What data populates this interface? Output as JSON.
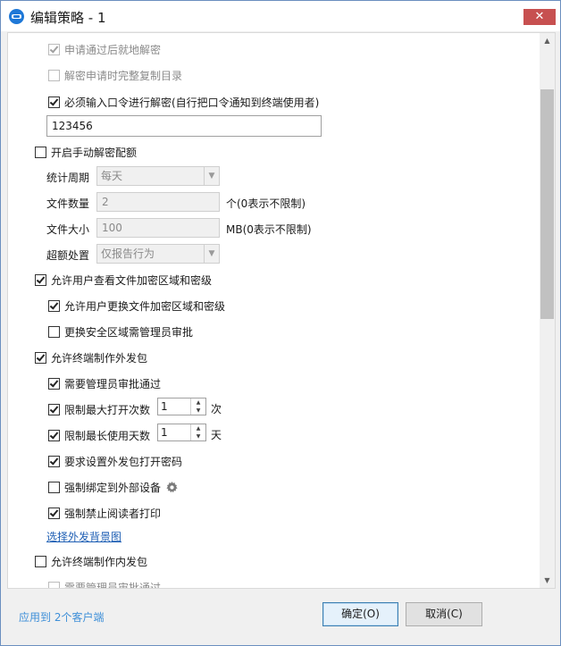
{
  "window": {
    "title": "编辑策略 - 1",
    "close_glyph": "✕"
  },
  "options": {
    "decrypt_after_approval": {
      "label": "申请通过后就地解密",
      "checked": true,
      "disabled": true
    },
    "copy_directory": {
      "label": "解密申请时完整复制目录",
      "checked": false,
      "disabled": true
    },
    "require_password": {
      "label": "必须输入口令进行解密(自行把口令通知到终端使用者)",
      "checked": true
    },
    "password_value": "123456",
    "manual_quota": {
      "label": "开启手动解密配额",
      "checked": false
    },
    "stat_period_label": "统计周期",
    "stat_period_value": "每天",
    "file_count_label": "文件数量",
    "file_count_value": "2",
    "file_count_hint": "个(0表示不限制)",
    "file_size_label": "文件大小",
    "file_size_value": "100",
    "file_size_hint": "MB(0表示不限制)",
    "overflow_label": "超额处置",
    "overflow_value": "仅报告行为",
    "view_area": {
      "label": "允许用户查看文件加密区域和密级",
      "checked": true
    },
    "change_area": {
      "label": "允许用户更换文件加密区域和密级",
      "checked": true
    },
    "change_area_approval": {
      "label": "更换安全区域需管理员审批",
      "checked": false
    },
    "make_outgoing": {
      "label": "允许终端制作外发包",
      "checked": true
    },
    "need_admin_approval": {
      "label": "需要管理员审批通过",
      "checked": true
    },
    "limit_open": {
      "label": "限制最大打开次数",
      "checked": true,
      "value": "1",
      "unit": "次"
    },
    "limit_days": {
      "label": "限制最长使用天数",
      "checked": true,
      "value": "1",
      "unit": "天"
    },
    "require_open_password": {
      "label": "要求设置外发包打开密码",
      "checked": true
    },
    "bind_device": {
      "label": "强制绑定到外部设备",
      "checked": false,
      "icon": "gear-icon"
    },
    "forbid_print": {
      "label": "强制禁止阅读者打印",
      "checked": true
    },
    "choose_background": "选择外发背景图",
    "make_internal": {
      "label": "允许终端制作内发包",
      "checked": false
    },
    "internal_admin_approval": {
      "label": "需要管理员审批通过",
      "checked": false,
      "disabled": true
    }
  },
  "footer": {
    "apply_to": "应用到 2个客户端",
    "ok_label": "确定(O)",
    "cancel_label": "取消(C)"
  },
  "colors": {
    "accent": "#1e78d7",
    "link": "#1f5fb4",
    "close": "#c75050"
  }
}
